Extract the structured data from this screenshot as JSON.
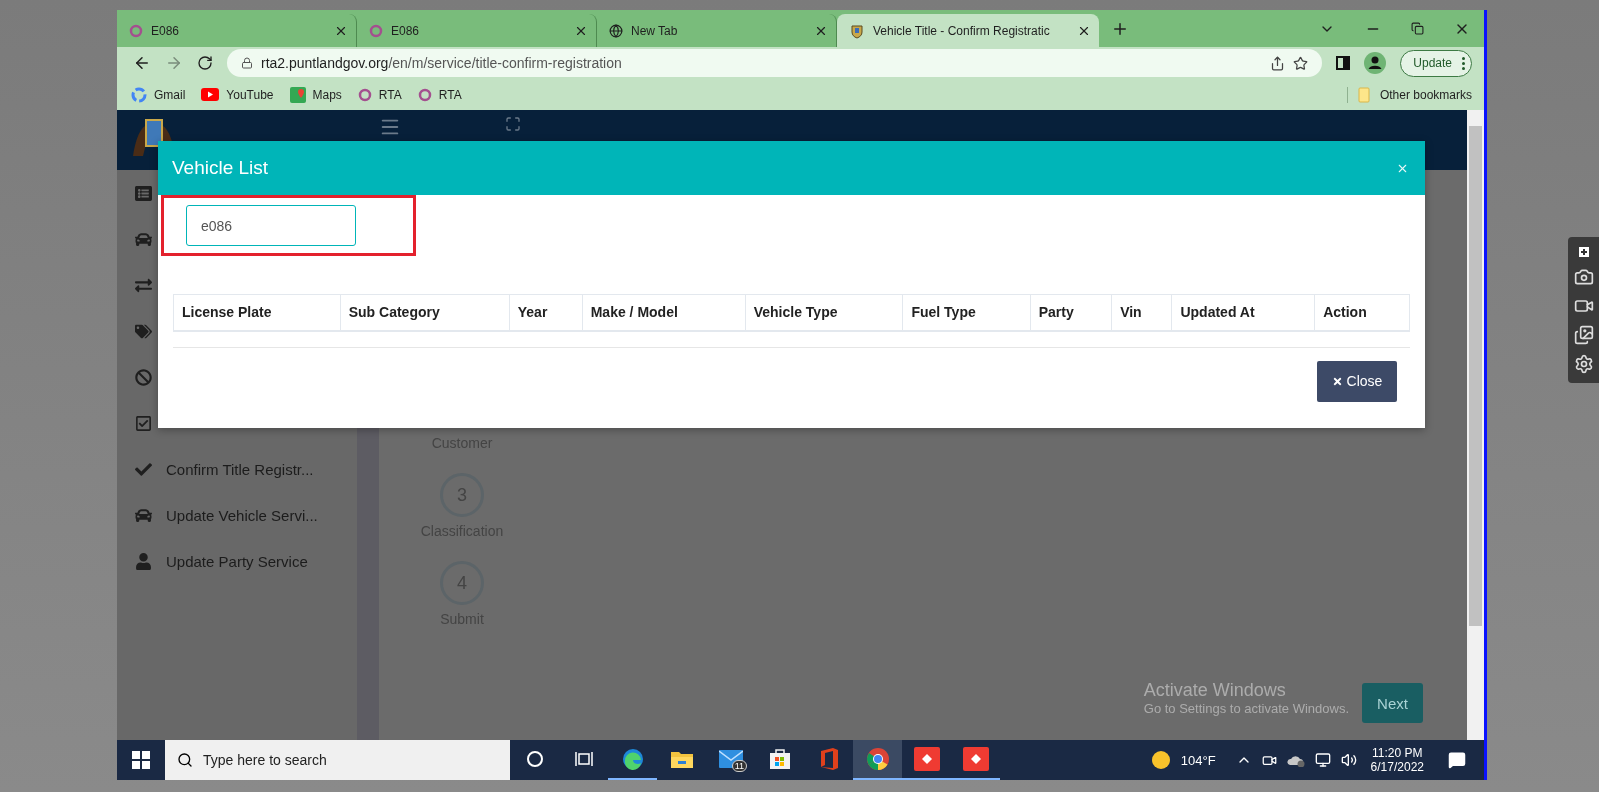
{
  "browser": {
    "tabs": [
      {
        "kind": "ring",
        "title": "E086",
        "selected": false
      },
      {
        "kind": "ring",
        "title": "E086",
        "selected": false
      },
      {
        "kind": "globe",
        "title": "New Tab",
        "selected": false
      },
      {
        "kind": "crest",
        "title": "Vehicle Title - Confirm Registratic",
        "selected": true
      }
    ],
    "address": {
      "host": "rta2.puntlandgov.org",
      "path": "/en/m/service/title-confirm-registration"
    },
    "update_button": "Update",
    "bookmarks": [
      {
        "kind": "google",
        "label": "Gmail"
      },
      {
        "kind": "youtube",
        "label": "YouTube"
      },
      {
        "kind": "maps",
        "label": "Maps"
      },
      {
        "kind": "ring",
        "label": "RTA"
      },
      {
        "kind": "ring",
        "label": "RTA"
      }
    ],
    "other_bookmarks": "Other bookmarks"
  },
  "page": {
    "sidebar": [
      {
        "kind": "list"
      },
      {
        "kind": "car"
      },
      {
        "kind": "exchange"
      },
      {
        "kind": "tags"
      },
      {
        "kind": "ban"
      },
      {
        "kind": "check-square"
      },
      {
        "kind": "check",
        "label": "Confirm Title Registr..."
      },
      {
        "kind": "car",
        "label": "Update Vehicle Servi..."
      },
      {
        "kind": "user",
        "label": "Update Party Service"
      }
    ],
    "steps": [
      {
        "label": "Customer"
      },
      {
        "number": "3",
        "label": "Classification"
      },
      {
        "number": "4",
        "label": "Submit"
      }
    ],
    "next_button": "Next"
  },
  "modal": {
    "title": "Vehicle List",
    "search_value": "e086",
    "columns": [
      "License Plate",
      "Sub Category",
      "Year",
      "Make / Model",
      "Vehicle Type",
      "Fuel Type",
      "Party",
      "Vin",
      "Updated At",
      "Action"
    ],
    "close_button": "Close"
  },
  "windows_notice": {
    "title": "Activate Windows",
    "subtitle": "Go to Settings to activate Windows."
  },
  "taskbar": {
    "search_placeholder": "Type here to search",
    "apps": [
      {
        "kind": "cortana",
        "running": false,
        "selected": false
      },
      {
        "kind": "taskview",
        "running": false,
        "selected": false
      },
      {
        "kind": "edge",
        "running": true,
        "selected": false
      },
      {
        "kind": "explorer",
        "running": false,
        "selected": false
      },
      {
        "kind": "mail",
        "badge": "11",
        "running": false,
        "selected": false
      },
      {
        "kind": "store",
        "running": false,
        "selected": false
      },
      {
        "kind": "office",
        "running": false,
        "selected": false
      },
      {
        "kind": "chrome",
        "running": true,
        "selected": true
      },
      {
        "kind": "remote",
        "running": true,
        "selected": false
      },
      {
        "kind": "remote",
        "running": true,
        "selected": false
      }
    ],
    "weather": "104°F",
    "time": "11:20 PM",
    "date": "6/17/2022"
  }
}
